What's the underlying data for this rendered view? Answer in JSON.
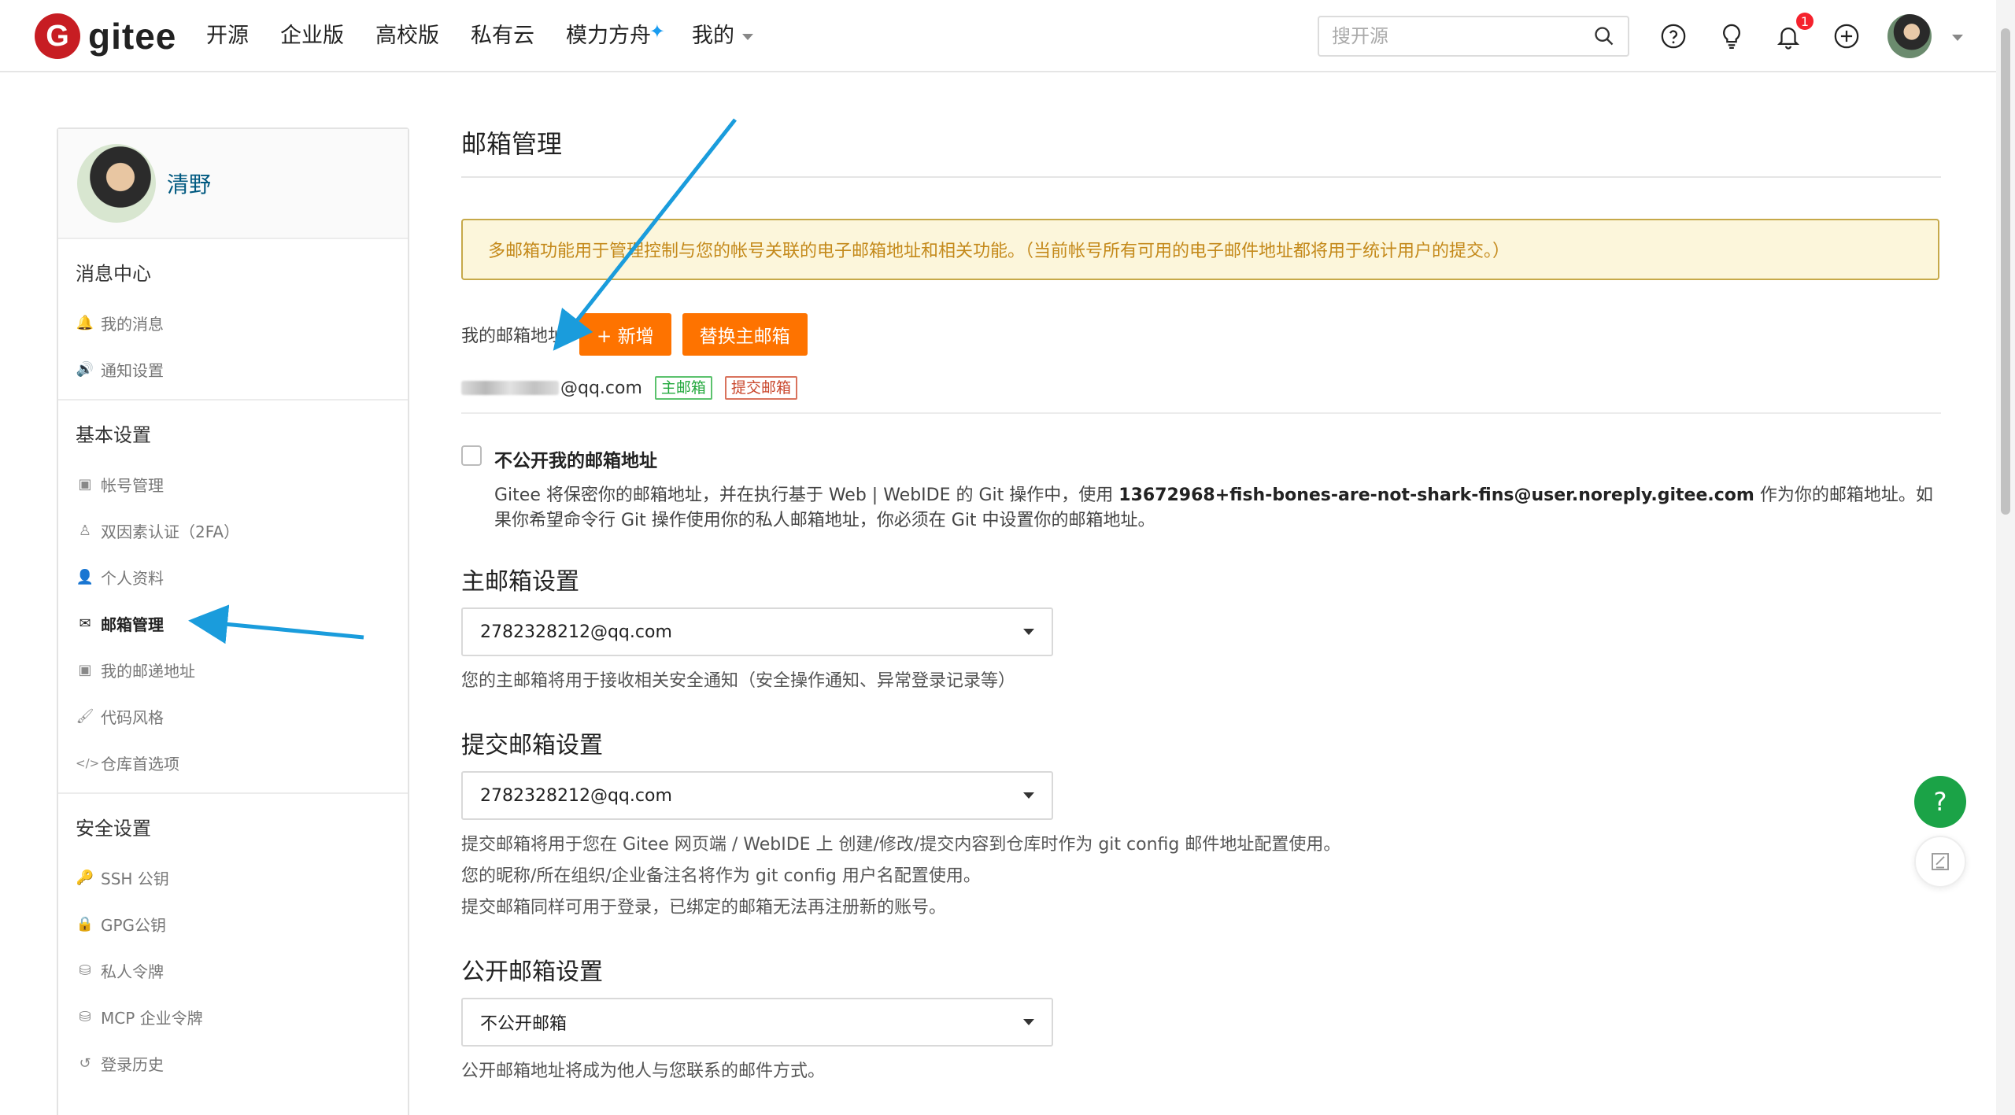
{
  "header": {
    "logo_mark": "G",
    "logo_text": "gitee",
    "nav": [
      "开源",
      "企业版",
      "高校版",
      "私有云",
      "模力方舟",
      "我的"
    ],
    "nav_star": "✦",
    "search_placeholder": "搜开源",
    "notification_count": "1"
  },
  "sidebar": {
    "user_name": "清野",
    "groups": [
      {
        "title": "消息中心",
        "items": [
          {
            "label": "我的消息",
            "icon": "bell-icon",
            "glyph": "🔔"
          },
          {
            "label": "通知设置",
            "icon": "speaker-icon",
            "glyph": "🔊"
          }
        ]
      },
      {
        "title": "基本设置",
        "items": [
          {
            "label": "帐号管理",
            "icon": "id-card-icon",
            "glyph": "▣"
          },
          {
            "label": "双因素认证（2FA）",
            "icon": "user-lock-icon",
            "glyph": "♙"
          },
          {
            "label": "个人资料",
            "icon": "user-icon",
            "glyph": "👤"
          },
          {
            "label": "邮箱管理",
            "icon": "envelope-icon",
            "glyph": "✉",
            "active": true
          },
          {
            "label": "我的邮递地址",
            "icon": "address-card-icon",
            "glyph": "▣"
          },
          {
            "label": "代码风格",
            "icon": "brush-icon",
            "glyph": "🖌"
          },
          {
            "label": "仓库首选项",
            "icon": "code-icon",
            "glyph": "</>"
          }
        ]
      },
      {
        "title": "安全设置",
        "items": [
          {
            "label": "SSH 公钥",
            "icon": "key-icon",
            "glyph": "🔑"
          },
          {
            "label": "GPG公钥",
            "icon": "lock-icon",
            "glyph": "🔒"
          },
          {
            "label": "私人令牌",
            "icon": "token-icon",
            "glyph": "⛁"
          },
          {
            "label": "MCP 企业令牌",
            "icon": "token-icon",
            "glyph": "⛁"
          },
          {
            "label": "登录历史",
            "icon": "history-icon",
            "glyph": "↺"
          }
        ]
      }
    ]
  },
  "main": {
    "title": "邮箱管理",
    "notice": "多邮箱功能用于管理控制与您的帐号关联的电子邮箱地址和相关功能。（当前帐号所有可用的电子邮件地址都将用于统计用户的提交。）",
    "my_email_label": "我的邮箱地址",
    "add_button": "+ 新增",
    "replace_button": "替换主邮箱",
    "email_suffix": "@qq.com",
    "tag_primary": "主邮箱",
    "tag_commit": "提交邮箱",
    "privacy_title": "不公开我的邮箱地址",
    "privacy_desc_1": "Gitee 将保密你的邮箱地址，并在执行基于 Web | WebIDE 的 Git 操作中，使用 ",
    "privacy_desc_bold": "13672968+fish-bones-are-not-shark-fins@user.noreply.gitee.com",
    "privacy_desc_2": " 作为你的邮箱地址。如果你希望命令行 Git 操作使用你的私人邮箱地址，你必须在 Git 中设置你的邮箱地址。",
    "primary_title": "主邮箱设置",
    "primary_value": "2782328212@qq.com",
    "primary_hint": "您的主邮箱将用于接收相关安全通知（安全操作通知、异常登录记录等）",
    "commit_title": "提交邮箱设置",
    "commit_value": "2782328212@qq.com",
    "commit_hints": [
      "提交邮箱将用于您在 Gitee 网页端 / WebIDE 上 创建/修改/提交内容到仓库时作为 git config 邮件地址配置使用。",
      "您的昵称/所在组织/企业备注名将作为 git config 用户名配置使用。",
      "提交邮箱同样可用于登录，已绑定的邮箱无法再注册新的账号。"
    ],
    "public_title": "公开邮箱设置",
    "public_value": "不公开邮箱",
    "public_hint": "公开邮箱地址将成为他人与您联系的邮件方式。"
  },
  "floating": {
    "help_label": "?"
  },
  "colors": {
    "brand_red": "#c71d23",
    "orange": "#fe7300",
    "annotation_arrow": "#1a9cdc",
    "help_green": "#1ba347"
  }
}
